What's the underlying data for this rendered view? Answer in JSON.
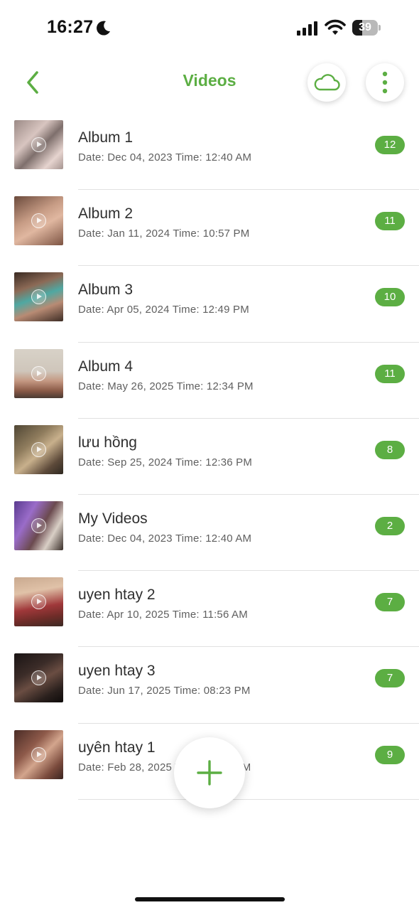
{
  "status_bar": {
    "time": "16:27",
    "battery": "39",
    "battery_level": 0.39,
    "icons": [
      "moon-icon",
      "signal-icon",
      "wifi-icon",
      "battery-icon"
    ]
  },
  "header": {
    "title": "Videos",
    "back_icon": "chevron-left-icon",
    "cloud_icon": "cloud-icon",
    "more_icon": "more-vertical-icon"
  },
  "albums": [
    {
      "name": "Album 1",
      "date": "Date: Dec 04, 2023 Time: 12:40 AM",
      "count": "12"
    },
    {
      "name": "Album 2",
      "date": "Date: Jan 11, 2024 Time: 10:57 PM",
      "count": "11"
    },
    {
      "name": "Album 3",
      "date": "Date: Apr 05, 2024 Time: 12:49 PM",
      "count": "10"
    },
    {
      "name": "Album 4",
      "date": "Date: May 26, 2025 Time: 12:34 PM",
      "count": "11"
    },
    {
      "name": "lưu hồng",
      "date": "Date: Sep 25, 2024 Time: 12:36 PM",
      "count": "8"
    },
    {
      "name": "My Videos",
      "date": "Date: Dec 04, 2023 Time: 12:40 AM",
      "count": "2"
    },
    {
      "name": "uyen htay 2",
      "date": "Date: Apr 10, 2025 Time: 11:56 AM",
      "count": "7"
    },
    {
      "name": "uyen htay 3",
      "date": "Date: Jun 17, 2025 Time: 08:23 PM",
      "count": "7"
    },
    {
      "name": "uyên htay 1",
      "date": "Date: Feb 28, 2025 Time: 10:04 AM",
      "count": "9"
    }
  ],
  "fab": {
    "icon": "plus-icon"
  },
  "colors": {
    "accent": "#5cae43",
    "divider": "#e1e1e1",
    "text": "#2f2f2f",
    "subtext": "#5f5f5f"
  }
}
